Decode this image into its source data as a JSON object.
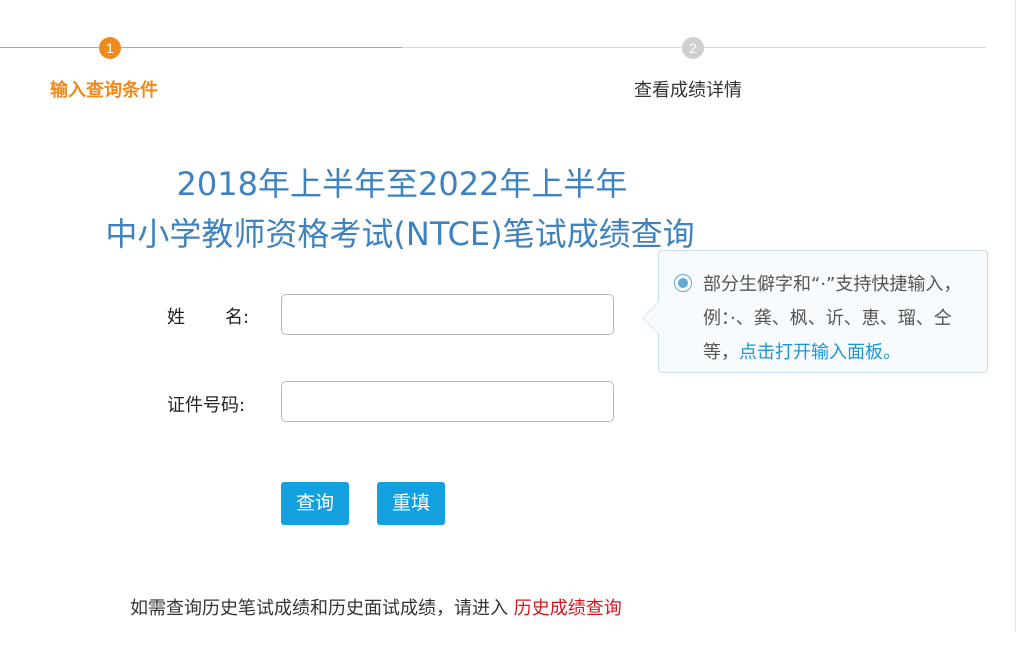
{
  "steps": [
    {
      "number": "1",
      "label": "输入查询条件",
      "state": "active"
    },
    {
      "number": "2",
      "label": "查看成绩详情",
      "state": "inactive"
    }
  ],
  "title": {
    "line1": "2018年上半年至2022年上半年",
    "line2": "中小学教师资格考试(NTCE)笔试成绩查询"
  },
  "form": {
    "name_label_part1": "姓",
    "name_label_part2": "名:",
    "name_value": "",
    "id_label": "证件号码:",
    "id_value": "",
    "query_button": "查询",
    "reset_button": "重填"
  },
  "tip": {
    "text": "部分生僻字和“·”支持快捷输入，例：·、龚、枫、䜣、恵、瑠、仝等，",
    "link": "点击打开输入面板。"
  },
  "footer": {
    "text": "如需查询历史笔试成绩和历史面试成绩，请进入",
    "link": "历史成绩查询"
  },
  "colors": {
    "accent_orange": "#f08a1d",
    "title_blue": "#3e82bf",
    "button_blue": "#13a0de",
    "link_blue": "#1a98d5",
    "link_red": "#d6161e"
  }
}
